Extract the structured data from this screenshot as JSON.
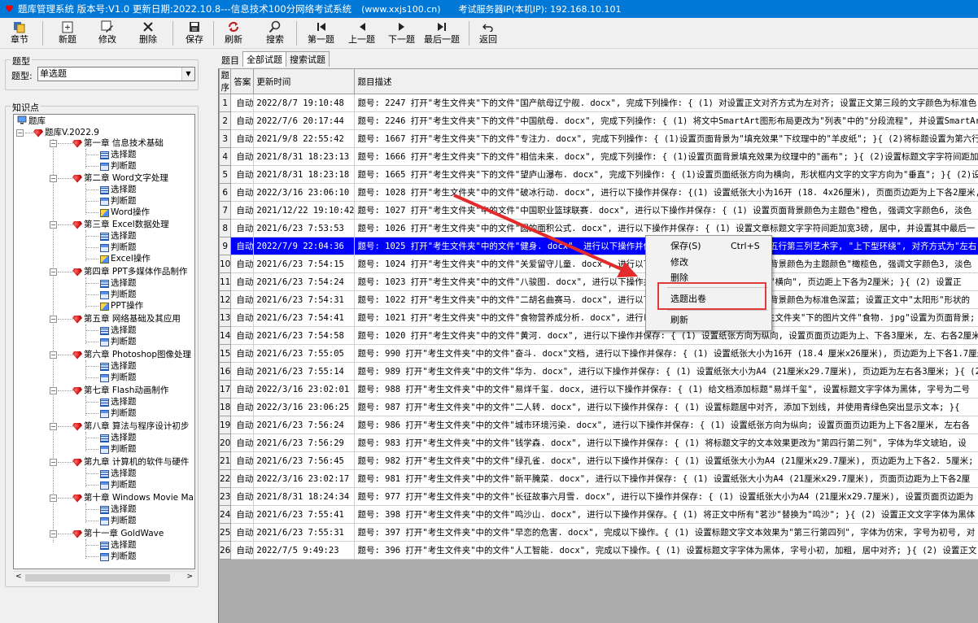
{
  "titlebar": {
    "title": "题库管理系统 版本号:V1.0 更新日期:2022.10.8---信息技术100分网络考试系统",
    "website": "(www.xxjs100.cn)",
    "server_ip": "考试服务器IP(本机IP): 192.168.10.101"
  },
  "toolbar": {
    "chapter": "章节",
    "new": "新题",
    "edit": "修改",
    "delete": "删除",
    "save": "保存",
    "refresh": "刷新",
    "search": "搜索",
    "first": "第一题",
    "prev": "上一题",
    "next": "下一题",
    "last": "最后一题",
    "back": "返回"
  },
  "left": {
    "type_group": "题型",
    "type_label": "题型:",
    "type_value": "单选题",
    "knowledge_group": "知识点",
    "tree": {
      "root": "题库",
      "bank": "题库V.2022.9",
      "choice": "选择题",
      "judge": "判断题",
      "ch1": "第一章 信息技术基础",
      "ch2": "第二章 Word文字处理",
      "ch2_op": "Word操作",
      "ch3": "第三章 Excel数据处理",
      "ch3_op": "Excel操作",
      "ch4": "第四章 PPT多媒体作品制作",
      "ch4_op": "PPT操作",
      "ch5": "第五章 网络基础及其应用",
      "ch6": "第六章 Photoshop图像处理",
      "ch7": "第七章 Flash动画制作",
      "ch8": "第八章 算法与程序设计初步",
      "ch9": "第九章 计算机的软件与硬件",
      "ch10": "第十章 Windows Movie Make",
      "ch11": "第十一章 GoldWave"
    }
  },
  "tabs": {
    "label": "题目",
    "all": "全部试题",
    "search": "搜索试题"
  },
  "grid": {
    "headers": [
      "题序",
      "答案",
      "更新时间",
      "题目描述"
    ],
    "rows": [
      [
        "1",
        "自动",
        "2022/8/7 19:10:48",
        "题号: 2247 打开\"考生文件夹\"下的文件\"国产航母辽宁舰. docx\", 完成下列操作: { (1) 对设置正文对齐方式为左对齐; 设置正文第三段的文字颜色为标准色"
      ],
      [
        "2",
        "自动",
        "2022/7/6 20:17:44",
        "题号: 2246 打开\"考生文件夹\"下的文件\"中国航母. docx\", 完成下列操作: { (1) 将文中SmartArt图形布局更改为\"列表\"中的\"分段流程\", 并设置SmartArt样式"
      ],
      [
        "3",
        "自动",
        "2021/9/8 22:55:42",
        "题号: 1667 打开\"考生文件夹\"下的文件\"专注力. docx\", 完成下列操作: { (1)设置页面背景为\"填充效果\"下纹理中的\"羊皮纸\"; }{ (2)将标题设置为第六行"
      ],
      [
        "4",
        "自动",
        "2021/8/31 18:23:13",
        "题号: 1666 打开\"考生文件夹\"下的文件\"相信未来. docx\", 完成下列操作: { (1)设置页面背景填充效果为纹理中的\"画布\"; }{ (2)设置标题文字字符间距加"
      ],
      [
        "5",
        "自动",
        "2021/8/31 18:23:18",
        "题号: 1665 打开\"考生文件夹\"下的文件\"望庐山瀑布. docx\", 完成下列操作: { (1)设置页面纸张方向为横向, 形状框内文字的文字方向为\"垂直\"; }{ (2)设"
      ],
      [
        "6",
        "自动",
        "2022/3/16 23:06:10",
        "题号: 1028 打开\"考生文件夹\"中的文件\"破冰行动. docx\", 进行以下操作并保存: {(1) 设置纸张大小为16开 (18. 4x26厘米), 页面页边距为上下各2厘米,"
      ],
      [
        "7",
        "自动",
        "2021/12/22 19:10:42",
        "题号: 1027 打开\"考生文件夹\"中的文件\"中国职业篮球联赛. docx\", 进行以下操作并保存: { (1) 设置页面背景颜色为主题色\"橙色, 强调文字颜色6, 淡色"
      ],
      [
        "8",
        "自动",
        "2021/6/23 7:53:53",
        "题号: 1026 打开\"考生文件夹\"中的文件\"圆的面积公式. docx\", 进行以下操作并保存: { (1) 设置文章标题文字字符间距加宽3磅, 居中, 并设置其中最后一"
      ],
      [
        "9",
        "自动",
        "2022/7/9 22:04:36",
        "题号: 1025 打开\"考生文件夹\"中的文件\"健身. docx\", 进行以下操作并保存: { (1) 设置标题文字为第五行第三列艺术字, \"上下型环绕\", 对齐方式为\"左右"
      ],
      [
        "10",
        "自动",
        "2021/6/23 7:54:15",
        "题号: 1024 打开\"考生文件夹\"中的文件\"关爱留守儿童. docx\", 进行以下操作并保存: { (1) 设置页面背景颜色为主题颜色\"橄榄色, 强调文字颜色3, 淡色"
      ],
      [
        "11",
        "自动",
        "2021/6/23 7:54:24",
        "题号: 1023 打开\"考生文件夹\"中的文件\"八骏图. docx\", 进行以下操作并保存: { (1) 设置纸张方向为\"横向\", 页边距上下各为2厘米; }{ (2) 设置正"
      ],
      [
        "12",
        "自动",
        "2021/6/23 7:54:31",
        "题号: 1022 打开\"考生文件夹\"中的文件\"二胡名曲赛马. docx\", 进行以下操作并保存: { (1) 设置页面背景颜色为标准色深蓝; 设置正文中\"太阳形\"形状的"
      ],
      [
        "13",
        "自动",
        "2021/6/23 7:54:41",
        "题号: 1021 打开\"考生文件夹\"中的文件\"食物营养成分析. docx\", 进行以下操作并保存: { (1) 将\"考生文件夹\"下的图片文件\"食物. jpg\"设置为页面背景;"
      ],
      [
        "14",
        "自动",
        "2021/6/23 7:54:58",
        "题号: 1020 打开\"考生文件夹\"中的文件\"黄河. docx\", 进行以下操作并保存: { (1) 设置纸张方向为纵向, 设置页面页边距为上、下各3厘米, 左、右各2厘米;"
      ],
      [
        "15",
        "自动",
        "2021/6/23 7:55:05",
        "题号: 990 打开\"考生文件夹\"中的文件\"奋斗. docx\"文档, 进行以下操作并保存: { (1) 设置纸张大小为16开 (18.4 厘米x26厘米), 页边距为上下各1.7厘米"
      ],
      [
        "16",
        "自动",
        "2021/6/23 7:55:14",
        "题号: 989 打开\"考生文件夹\"中的文件\"华为. docx\", 进行以下操作并保存: { (1) 设置纸张大小为A4 (21厘米x29.7厘米), 页边距为左右各3厘米; }{ (2)"
      ],
      [
        "17",
        "自动",
        "2022/3/16 23:02:01",
        "题号: 988 打开\"考生文件夹\"中的文件\"易烊千玺. docx, 进行以下操作并保存: { (1) 给文档添加标题\"易烊千玺\", 设置标题文字字体为黑体, 字号为二号"
      ],
      [
        "18",
        "自动",
        "2022/3/16 23:06:25",
        "题号: 987 打开\"考生文件夹\"中的文件\"二人转. docx\", 进行以下操作并保存: { (1) 设置标题居中对齐, 添加下划线, 并使用青绿色突出显示文本; }{"
      ],
      [
        "19",
        "自动",
        "2021/6/23 7:56:24",
        "题号: 986 打开\"考生文件夹\"中的文件\"城市环境污染. docx\", 进行以下操作并保存: { (1) 设置纸张方向为纵向; 设置页面页边距为上下各2厘米, 左右各"
      ],
      [
        "20",
        "自动",
        "2021/6/23 7:56:29",
        "题号: 983 打开\"考生文件夹\"中的文件\"钱学森. docx\", 进行以下操作并保存: { (1) 将标题文字的文本效果更改为\"第四行第二列\", 字体为华文琥珀, 设"
      ],
      [
        "21",
        "自动",
        "2021/6/23 7:56:45",
        "题号: 982 打开\"考生文件夹\"中的文件\"绿孔雀. docx\", 进行以下操作并保存: { (1) 设置纸张大小为A4 (21厘米x29.7厘米), 页边距为上下各2. 5厘米;"
      ],
      [
        "22",
        "自动",
        "2022/3/16 23:02:17",
        "题号: 981 打开\"考生文件夹\"中的文件\"新平腌菜. docx\", 进行以下操作并保存: { (1) 设置纸张大小为A4 (21厘米x29.7厘米), 页面页边距为上下各2厘"
      ],
      [
        "23",
        "自动",
        "2021/8/31 18:24:34",
        "题号: 977 打开\"考生文件夹\"中的文件\"长征故事六月雪. docx\", 进行以下操作并保存: { (1) 设置纸张大小为A4 (21厘米x29.7厘米), 设置页面页边距为"
      ],
      [
        "24",
        "自动",
        "2021/6/23 7:55:41",
        "题号: 398 打开\"考生文件夹\"中的文件\"鸣沙山. docx\", 进行以下操作并保存。{ (1) 将正文中所有\"茗沙\"替换为\"鸣沙\"; }{ (2) 设置正文文字字体为黑体"
      ],
      [
        "25",
        "自动",
        "2021/6/23 7:55:31",
        "题号: 397 打开\"考生文件夹\"中的文件\"早恋的危害. docx\", 完成以下操作。{ (1) 设置标题文字文本效果为\"第三行第四列\", 字体为仿宋, 字号为初号, 对"
      ],
      [
        "26",
        "自动",
        "2022/7/5 9:49:23",
        "题号: 396 打开\"考生文件夹\"中的文件\"人工智能. docx\", 完成以下操作。{ (1) 设置标题文字字体为黑体, 字号小初, 加粗, 居中对齐; }{ (2) 设置正文"
      ]
    ]
  },
  "context_menu": {
    "save": "保存(S)",
    "save_shortcut": "Ctrl+S",
    "edit": "修改",
    "delete": "删除",
    "select_exam": "选题出卷",
    "refresh": "刷新"
  },
  "colors": {
    "titlebar": "#0078d7",
    "selection": "#0000ff",
    "highlight_box": "#e23b3b",
    "annotation_arrow": "#e32b2b"
  }
}
